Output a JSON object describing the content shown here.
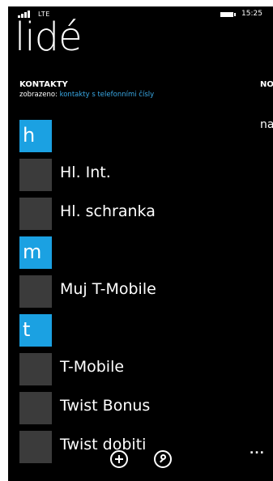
{
  "status": {
    "network": "LTE",
    "time": "15:25"
  },
  "app": {
    "title": "lidé"
  },
  "pivot": {
    "current_title": "KONTAKTY",
    "filter_prefix": "zobrazeno: ",
    "filter_link": "kontakty s telefonními čísly",
    "next_title": "NO",
    "next_content": "na"
  },
  "contacts": {
    "groups": [
      {
        "letter": "h",
        "names": [
          "Hl. Int.",
          "Hl. schranka"
        ]
      },
      {
        "letter": "m",
        "names": [
          "Muj T-Mobile"
        ]
      },
      {
        "letter": "t",
        "names": [
          "T-Mobile",
          "Twist Bonus",
          "Twist dobiti"
        ]
      }
    ]
  },
  "appbar": {
    "buttons": [
      {
        "icon": "add-icon"
      },
      {
        "icon": "search-icon"
      }
    ],
    "more": "..."
  },
  "colors": {
    "accent": "#1ba1e2",
    "link": "#3aa9e6",
    "avatar": "#3b3b3b",
    "background": "#000000"
  }
}
